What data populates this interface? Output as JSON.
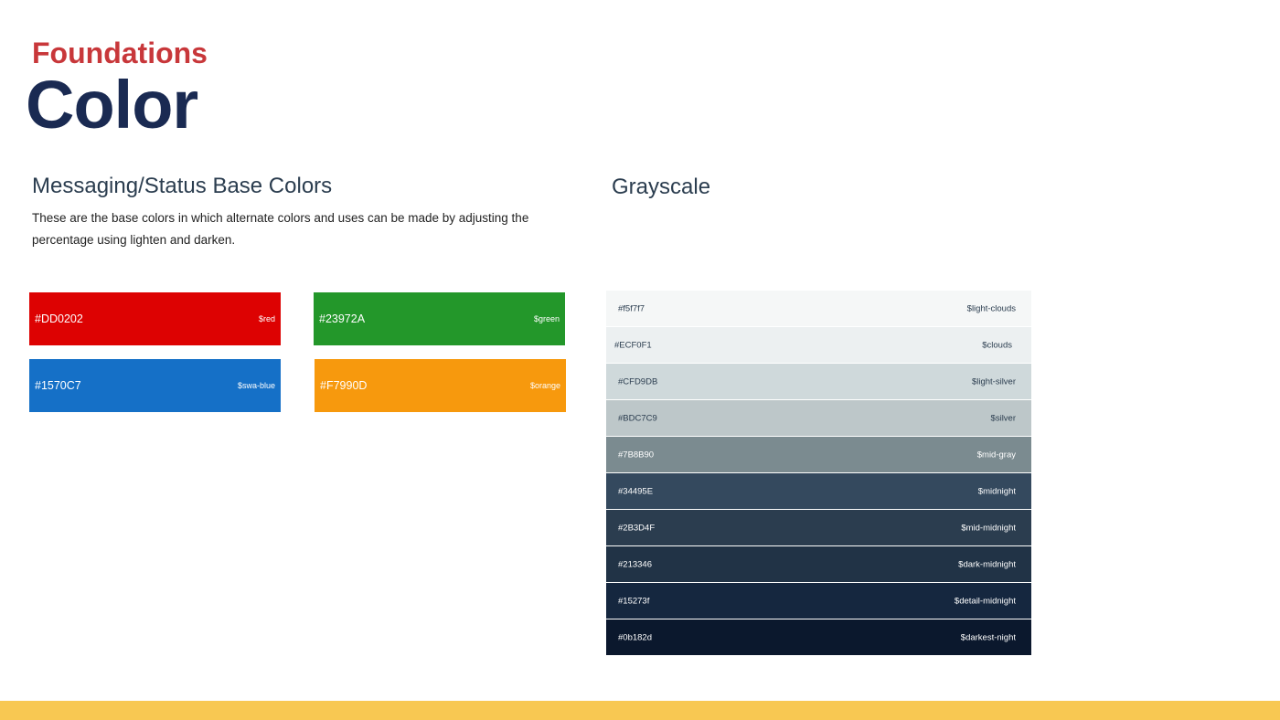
{
  "header": {
    "eyebrow": "Foundations",
    "title": "Color"
  },
  "messaging": {
    "heading": "Messaging/Status Base Colors",
    "description": "These are the base colors in which alternate colors and uses can be made by adjusting the percentage using lighten and darken.",
    "swatches": [
      {
        "hex": "#DD0202",
        "var": "$red",
        "color": "#DD0202"
      },
      {
        "hex": "#23972A",
        "var": "$green",
        "color": "#23972A"
      },
      {
        "hex": "#1570C7",
        "var": "$swa-blue",
        "color": "#1570C7"
      },
      {
        "hex": "#F7990D",
        "var": "$orange",
        "color": "#F7990D"
      }
    ]
  },
  "grayscale": {
    "heading": "Grayscale",
    "rows": [
      {
        "hex": "#f5f7f7",
        "var": "$light-clouds",
        "color": "#f5f7f7",
        "text_color": "#2b3d4f"
      },
      {
        "hex": "#ECF0F1",
        "var": "$clouds",
        "color": "#ECF0F1",
        "text_color": "#2b3d4f"
      },
      {
        "hex": "#CFD9DB",
        "var": "$light-silver",
        "color": "#CFD9DB",
        "text_color": "#2b3d4f"
      },
      {
        "hex": "#BDC7C9",
        "var": "$silver",
        "color": "#BDC7C9",
        "text_color": "#2b3d4f"
      },
      {
        "hex": "#7B8B90",
        "var": "$mid-gray",
        "color": "#7B8B90",
        "text_color": "#ffffff"
      },
      {
        "hex": "#34495E",
        "var": "$midnight",
        "color": "#34495E",
        "text_color": "#ffffff"
      },
      {
        "hex": "#2B3D4F",
        "var": "$mid-midnight",
        "color": "#2B3D4F",
        "text_color": "#ffffff"
      },
      {
        "hex": "#213346",
        "var": "$dark-midnight",
        "color": "#213346",
        "text_color": "#ffffff"
      },
      {
        "hex": "#15273f",
        "var": "$detail-midnight",
        "color": "#15273f",
        "text_color": "#ffffff"
      },
      {
        "hex": "#0b182d",
        "var": "$darkest-night",
        "color": "#0b182d",
        "text_color": "#ffffff"
      }
    ]
  },
  "colors": {
    "eyebrow": "#c8373a",
    "title": "#1a2a52",
    "footer_bar": "#f8c852"
  }
}
